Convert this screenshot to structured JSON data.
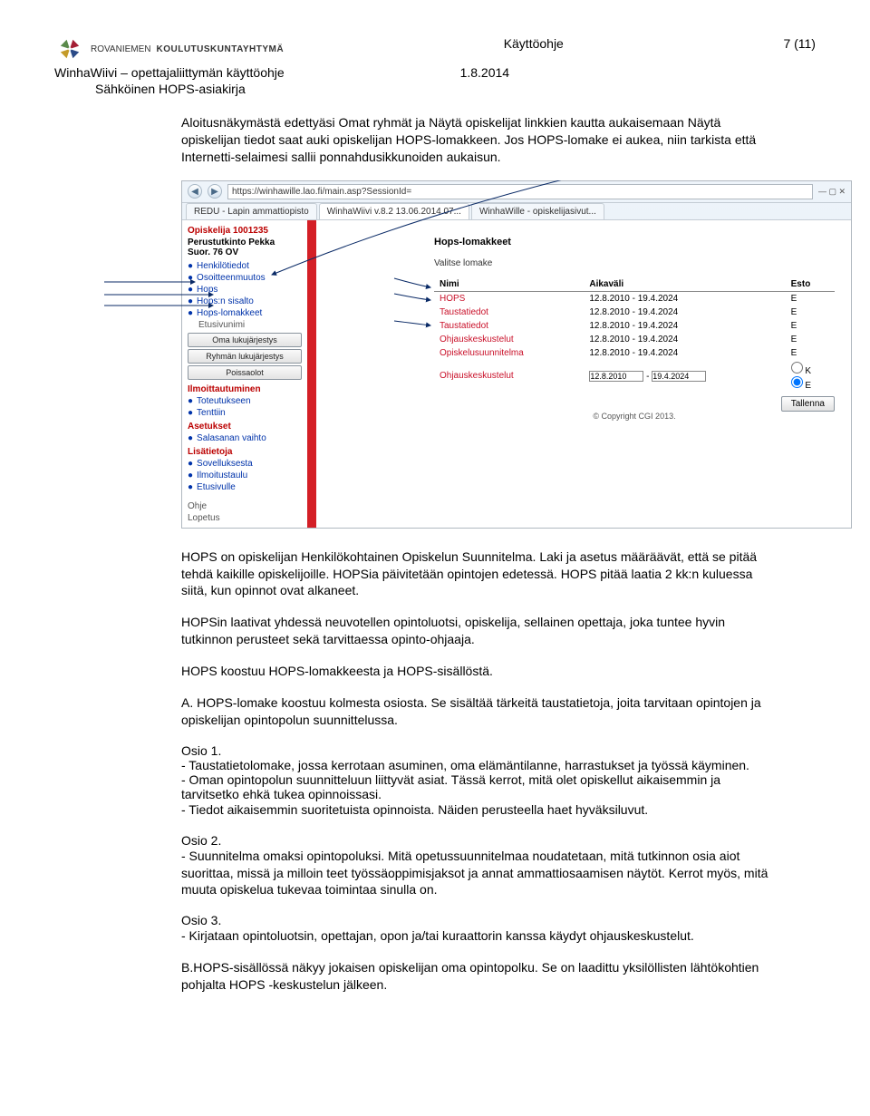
{
  "header": {
    "logo_text1": "ROVANIEMEN",
    "logo_text2": "KOULUTUSKUNTAYHTYMÄ",
    "center_title": "Käyttöohje",
    "page_number": "7 (11)",
    "sub_left": "WinhaWiivi – opettajaliittymän käyttöohje",
    "sub_date": "1.8.2014",
    "sub_indent": "Sähköinen HOPS-asiakirja"
  },
  "intro_para": "Aloitusnäkymästä edettyäsi Omat ryhmät ja Näytä opiskelijat linkkien kautta aukaisemaan Näytä opiskelijan tiedot saat auki opiskelijan HOPS-lomakkeen. Jos HOPS-lomake ei aukea, niin tarkista että Internetti-selaimesi sallii ponnahdusikkunoiden aukaisun.",
  "browser": {
    "url": "https://winhawille.lao.fi/main.asp?SessionId=",
    "tabs": [
      "REDU - Lapin ammattiopisto",
      "WinhaWiivi v.8.2 13.06.2014 07...",
      "WinhaWille - opiskelijasivut..."
    ]
  },
  "sidebar": {
    "student_id": "Opiskelija 1001235",
    "student_name": "Perustutkinto Pekka",
    "suor": "Suor. 76 OV",
    "items": [
      "Henkilötiedot",
      "Osoitteenmuutos",
      "Hops",
      "Hops:n sisalto",
      "Hops-lomakkeet"
    ],
    "sub_muted": "Etusivunimi",
    "buttons": [
      "Oma lukujärjestys",
      "Ryhmän lukujärjestys",
      "Poissaolot"
    ],
    "sec_ilmo": "Ilmoittautuminen",
    "ilmo_items": [
      "Toteutukseen",
      "Tenttiin"
    ],
    "sec_aset": "Asetukset",
    "aset_items": [
      "Salasanan vaihto"
    ],
    "sec_lisa": "Lisätietoja",
    "lisa_items": [
      "Sovelluksesta",
      "Ilmoitustaulu",
      "Etusivulle"
    ],
    "ohje": "Ohje",
    "lopetus": "Lopetus"
  },
  "panel": {
    "title": "Hops-lomakkeet",
    "choose": "Valitse lomake",
    "th_nimi": "Nimi",
    "th_aika": "Aikaväli",
    "th_esto": "Esto",
    "rows": [
      {
        "n": "HOPS",
        "a": "12.8.2010 - 19.4.2024",
        "e": "E"
      },
      {
        "n": "Taustatiedot",
        "a": "12.8.2010 - 19.4.2024",
        "e": "E"
      },
      {
        "n": "Taustatiedot",
        "a": "12.8.2010 - 19.4.2024",
        "e": "E"
      },
      {
        "n": "Ohjauskeskustelut",
        "a": "12.8.2010 - 19.4.2024",
        "e": "E"
      },
      {
        "n": "Opiskelusuunnitelma",
        "a": "12.8.2010 - 19.4.2024",
        "e": "E"
      }
    ],
    "extra_row_name": "Ohjauskeskustelut",
    "extra_date1": "12.8.2010",
    "extra_date2": "19.4.2024",
    "k": "K",
    "e": "E",
    "save": "Tallenna",
    "copyright": "© Copyright CGI 2013."
  },
  "para1": "HOPS on opiskelijan Henkilökohtainen Opiskelun Suunnitelma. Laki ja asetus määräävät, että se pitää tehdä kaikille opiskelijoille. HOPSia päivitetään opintojen edetessä. HOPS pitää laatia 2 kk:n kuluessa siitä, kun opinnot ovat alkaneet.",
  "para2": "HOPSin laativat yhdessä neuvotellen opintoluotsi, opiskelija, sellainen opettaja, joka tuntee hyvin tutkinnon perusteet sekä tarvittaessa opinto-ohjaaja.",
  "para3": "HOPS koostuu HOPS-lomakkeesta ja HOPS-sisällöstä.",
  "para4": "A. HOPS-lomake koostuu kolmesta osiosta. Se sisältää tärkeitä taustatietoja, joita tarvitaan opintojen ja opiskelijan opintopolun suunnittelussa.",
  "osio1_t": "Osio 1.",
  "osio1_a": "- Taustatietolomake, jossa kerrotaan asuminen, oma elämäntilanne, harrastukset ja työssä käyminen.",
  "osio1_b": "- Oman opintopolun suunnitteluun liittyvät asiat. Tässä kerrot, mitä olet opiskellut aikaisemmin ja tarvitsetko ehkä tukea opinnoissasi.",
  "osio1_c": "- Tiedot aikaisemmin suoritetuista opinnoista. Näiden perusteella haet hyväksiluvut.",
  "osio2_t": "Osio 2.",
  "osio2_a": "- Suunnitelma omaksi opintopoluksi. Mitä opetussuunnitelmaa noudatetaan, mitä tutkinnon osia aiot suorittaa, missä ja milloin teet työssäoppimisjaksot ja annat ammattiosaamisen näytöt. Kerrot myös, mitä muuta opiskelua tukevaa toimintaa sinulla on.",
  "osio3_t": "Osio 3.",
  "osio3_a": "- Kirjataan opintoluotsin, opettajan, opon ja/tai kuraattorin kanssa käydyt ohjauskeskustelut.",
  "final": "B.HOPS-sisällössä näkyy jokaisen opiskelijan oma opintopolku. Se on laadittu yksilöllisten lähtökohtien pohjalta HOPS -keskustelun jälkeen."
}
